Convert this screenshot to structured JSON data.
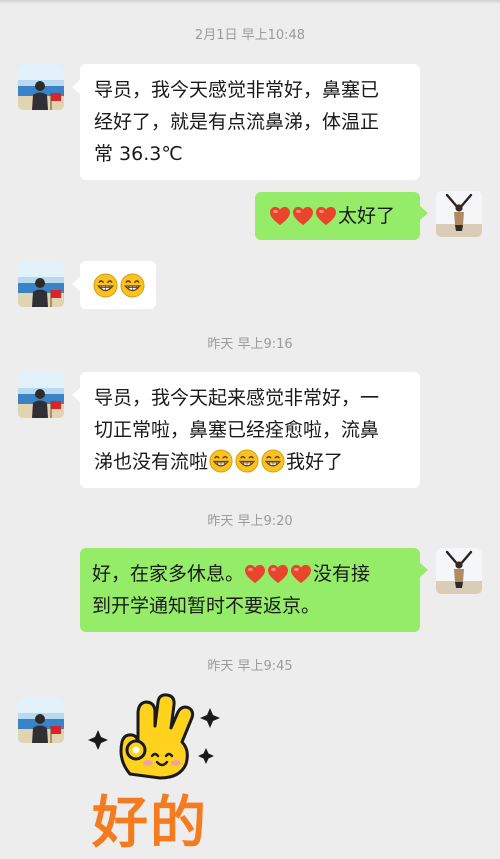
{
  "timestamps": [
    "2月1日 早上10:48",
    "昨天 早上9:16",
    "昨天 早上9:20",
    "昨天 早上9:45"
  ],
  "messages": [
    {
      "sender": "student",
      "lines": [
        "导员，我今天感觉非常好，鼻塞已",
        "经好了，就是有点流鼻涕，体温正",
        "常 36.3℃"
      ]
    },
    {
      "sender": "me",
      "emoji": [
        "red-heart",
        "red-heart",
        "red-heart"
      ],
      "text": "太好了"
    },
    {
      "sender": "student",
      "emoji": [
        "grinning-face",
        "grinning-face"
      ]
    },
    {
      "sender": "student",
      "line1": "导员，我今天起来感觉非常好，一",
      "line2": "切正常啦，鼻塞已经痊愈啦，流鼻",
      "line3_text": "涕也没有流啦",
      "line3_emoji": [
        "grinning-face",
        "grinning-face",
        "grinning-face"
      ],
      "line3_tail": "我好了"
    },
    {
      "sender": "me",
      "line1_text": "好，在家多休息。",
      "line1_emoji": [
        "red-heart",
        "red-heart",
        "red-heart"
      ],
      "line1_tail": "没有接",
      "line2": "到开学通知暂时不要返京。"
    },
    {
      "sender": "student",
      "sticker": {
        "name": "ok-hand-sticker",
        "text": "好的"
      }
    }
  ],
  "colors": {
    "background": "#ededed",
    "me_bubble": "#95ec69",
    "other_bubble": "#ffffff",
    "timestamp": "#9b9b9b",
    "heart": "#e8452c",
    "sticker_text": "#f47b20"
  }
}
